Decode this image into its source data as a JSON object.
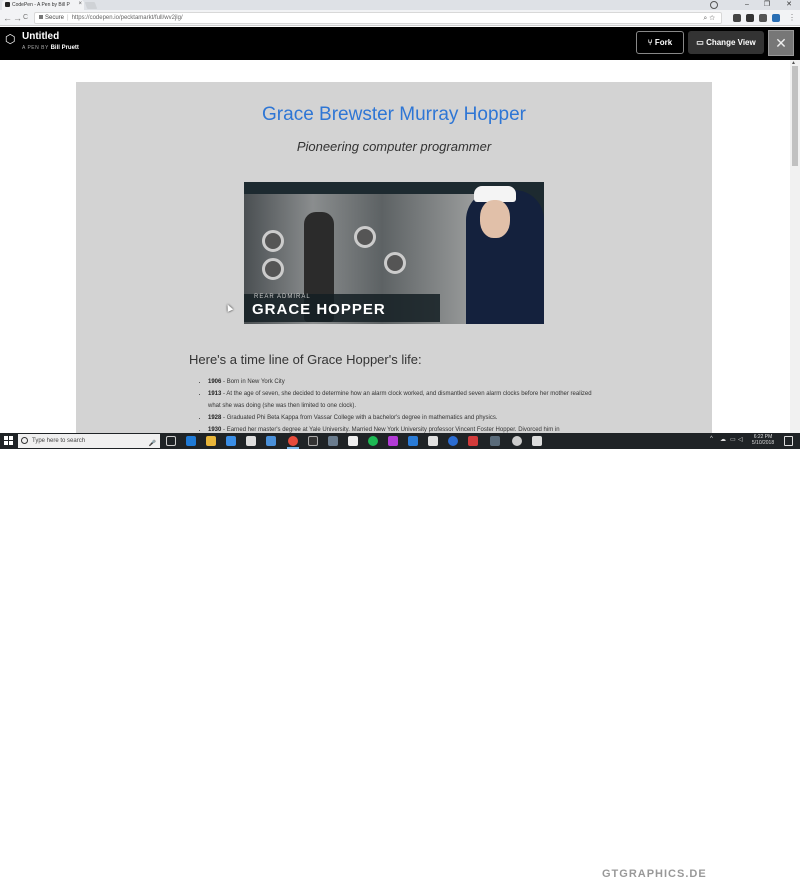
{
  "browser": {
    "tab_title": "CodePen - A Pen by Bill P",
    "tab_close": "×",
    "window_controls": [
      "–",
      "❐",
      "✕"
    ],
    "nav_buttons": [
      "←",
      "→",
      "C"
    ],
    "security_label": "Secure",
    "url": "https://codepen.io/pecktamarkt/full/wv2jlg/",
    "omnibox_icons": [
      "⌕",
      "☆"
    ]
  },
  "codepen": {
    "logo": "⬡",
    "title": "Untitled",
    "byline_prefix": "A PEN BY",
    "author": "Bill Pruett",
    "fork_label": "Fork",
    "fork_icon": "⑂",
    "change_view_label": "Change View",
    "change_view_icon": "▭",
    "avatar_glyph": "✕"
  },
  "page": {
    "heading": "Grace Brewster Murray Hopper",
    "subtitle": "Pioneering computer programmer",
    "image": {
      "rank_text": "REAR ADMIRAL",
      "name_text": "GRACE HOPPER"
    },
    "timeline_heading": "Here's a time line of Grace Hopper's life:",
    "timeline": [
      {
        "year": "1906",
        "text": "Born in New York City"
      },
      {
        "year": "1913",
        "text": "At the age of seven, she decided to determine how an alarm clock worked, and dismantled seven alarm clocks before her mother realized what she was doing (she was then limited to one clock)."
      },
      {
        "year": "1928",
        "text": "Graduated Phi Beta Kappa from Vassar College with a bachelor's degree in mathematics and physics."
      },
      {
        "year": "1930",
        "text": "Earned her master's degree at Yale University. Married New York University professor Vincent Foster Hopper. Divorced him in"
      }
    ]
  },
  "taskbar": {
    "search_placeholder": "Type here to search",
    "mic_icon": "🎤",
    "watermark": "GTGRAPHICS.DE",
    "tray_chevron": "^",
    "time": "6:22 PM",
    "date": "5/10/2018"
  },
  "colors": {
    "heading": "#2e76d5",
    "content_bg": "#d3d3d3",
    "codepen_header": "#000000",
    "taskbar": "#1f2326"
  }
}
